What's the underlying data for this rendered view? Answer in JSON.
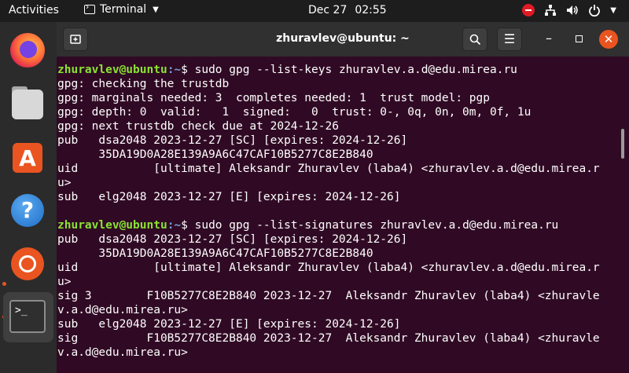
{
  "topbar": {
    "activities": "Activities",
    "app_menu": "Terminal",
    "date": "Dec 27",
    "time": "02:55",
    "tray_icons": [
      "do-not-disturb-icon",
      "network-icon",
      "volume-icon",
      "power-icon",
      "chevron-down-icon"
    ]
  },
  "dock": {
    "apps": [
      "firefox",
      "files",
      "ubuntu-software",
      "help",
      "ubuntu",
      "terminal"
    ]
  },
  "window": {
    "title": "zhuravlev@ubuntu: ~"
  },
  "terminal": {
    "lines": [
      {
        "user": "zhuravlev@ubuntu",
        "path": ":~",
        "text": "$ sudo gpg --list-keys zhuravlev.a.d@edu.mirea.ru"
      },
      {
        "text": "gpg: checking the trustdb"
      },
      {
        "text": "gpg: marginals needed: 3  completes needed: 1  trust model: pgp"
      },
      {
        "text": "gpg: depth: 0  valid:   1  signed:   0  trust: 0-, 0q, 0n, 0m, 0f, 1u"
      },
      {
        "text": "gpg: next trustdb check due at 2024-12-26"
      },
      {
        "text": "pub   dsa2048 2023-12-27 [SC] [expires: 2024-12-26]"
      },
      {
        "text": "      35DA19D0A28E139A9A6C47CAF10B5277C8E2B840"
      },
      {
        "text": "uid           [ultimate] Aleksandr Zhuravlev (laba4) <zhuravlev.a.d@edu.mirea.r"
      },
      {
        "text": "u>"
      },
      {
        "text": "sub   elg2048 2023-12-27 [E] [expires: 2024-12-26]"
      },
      {
        "text": ""
      },
      {
        "user": "zhuravlev@ubuntu",
        "path": ":~",
        "text": "$ sudo gpg --list-signatures zhuravlev.a.d@edu.mirea.ru"
      },
      {
        "text": "pub   dsa2048 2023-12-27 [SC] [expires: 2024-12-26]"
      },
      {
        "text": "      35DA19D0A28E139A9A6C47CAF10B5277C8E2B840"
      },
      {
        "text": "uid           [ultimate] Aleksandr Zhuravlev (laba4) <zhuravlev.a.d@edu.mirea.r"
      },
      {
        "text": "u>"
      },
      {
        "text": "sig 3        F10B5277C8E2B840 2023-12-27  Aleksandr Zhuravlev (laba4) <zhuravle"
      },
      {
        "text": "v.a.d@edu.mirea.ru>"
      },
      {
        "text": "sub   elg2048 2023-12-27 [E] [expires: 2024-12-26]"
      },
      {
        "text": "sig          F10B5277C8E2B840 2023-12-27  Aleksandr Zhuravlev (laba4) <zhuravle"
      },
      {
        "text": "v.a.d@edu.mirea.ru>"
      }
    ]
  },
  "colors": {
    "terminal_bg": "#300a24",
    "prompt_user": "#8ae234",
    "prompt_path": "#729fcf",
    "accent": "#e95420"
  }
}
